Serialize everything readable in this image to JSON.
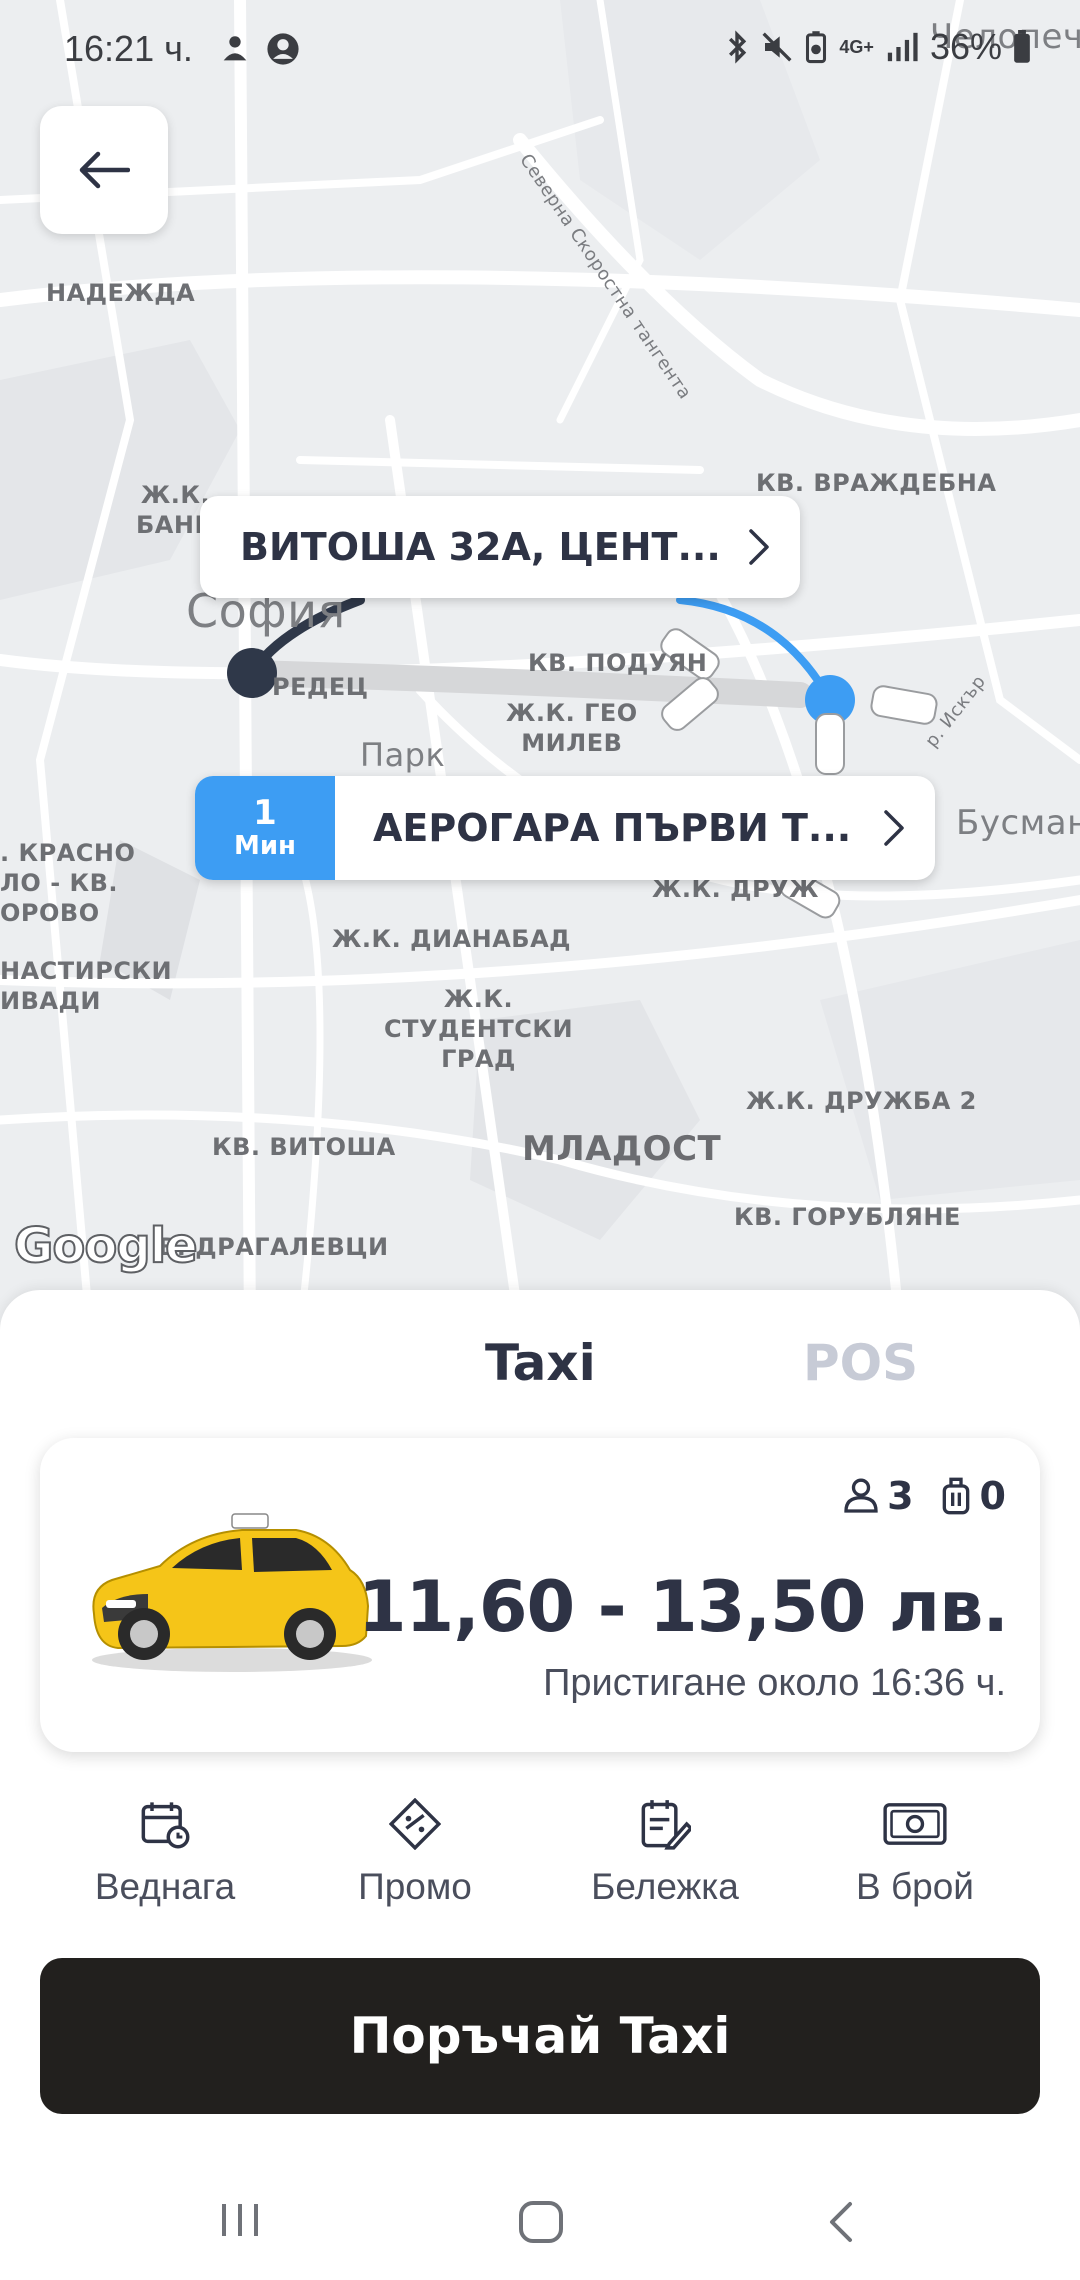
{
  "status_bar": {
    "time": "16:21 ч.",
    "battery": "36%",
    "network": "4G+"
  },
  "map": {
    "labels": {
      "nadezhda": "НАДЕЖДА",
      "banishora": "Ж.К.\nБАНИ",
      "vrazhdebna": "КВ. ВРАЖДЕБНА",
      "sofia": "София",
      "sredets": "РЕДЕЦ",
      "poduyane": "КВ. ПОДУЯН",
      "geo_milev": "Ж.К. ГЕО\nМИЛЕВ",
      "park": "Парк",
      "busmantsi": "Бусманц",
      "krasno_selo": ". КРАСНО\nЛО - КВ.\nОРОВО",
      "druzhba": "Ж.К. ДРУЖ",
      "dianabad": "Ж.К. ДИАНАБАД",
      "manastirski": "НАСТИРСКИ\nИВАДИ",
      "studentski": "Ж.К.\nСТУДЕНТСКИ\nГРАД",
      "druzhba2": "Ж.К. ДРУЖБА 2",
      "vitosha": "КВ. ВИТОША",
      "mladost": "МЛАДОСТ",
      "gorublyane": "КВ. ГОРУБЛЯНЕ",
      "dragalevtsi": "В. ДРАГАЛЕВЦИ",
      "chelopechene": "Челопечене",
      "ring_road": "Северна Скоростна тангента",
      "iskar": "р. Искър"
    },
    "google_logo": "Google"
  },
  "pickup": {
    "address": "ВИТОША 32А, ЦЕНТ..."
  },
  "dropoff": {
    "eta_value": "1",
    "eta_unit": "Мин",
    "address": "АЕРОГАРА ПЪРВИ Т..."
  },
  "tabs": {
    "taxi": "Taxi",
    "pos": "POS"
  },
  "ride": {
    "passengers": "3",
    "luggage": "0",
    "price": "11,60  - 13,50 лв.",
    "arrival": "Пристигане около 16:36 ч."
  },
  "options": {
    "now": "Веднага",
    "promo": "Промо",
    "note": "Бележка",
    "payment": "В брой"
  },
  "order_button": "Поръчай Taxi",
  "colors": {
    "accent": "#3d9df3",
    "dark": "#22201e",
    "text": "#2e3345",
    "muted_tab": "#c7cbd6",
    "taxi_yellow": "#f5c518"
  }
}
